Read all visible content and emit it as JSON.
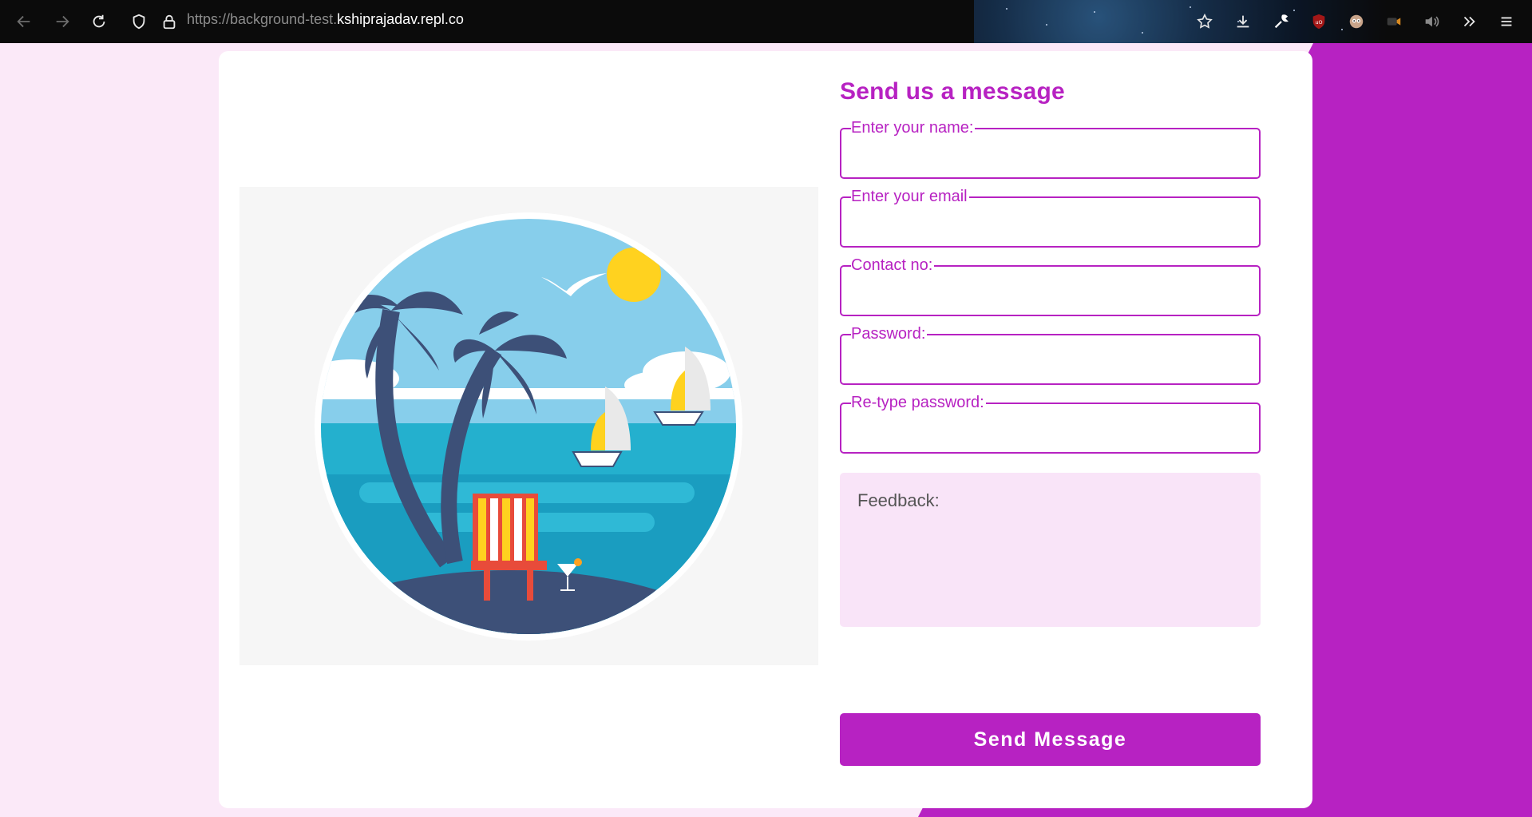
{
  "browser": {
    "url_prefix": "https://background-test.",
    "url_host": "kshiprajadav.repl.co",
    "icons": [
      "back-icon",
      "forward-icon",
      "reload-icon",
      "shield-icon",
      "lock-icon",
      "star-icon",
      "download-icon",
      "wrench-icon",
      "ublock-icon",
      "extension-face-icon",
      "extension-video-icon",
      "speaker-icon",
      "overflow-icon",
      "menu-icon"
    ]
  },
  "form": {
    "title": "Send us a message",
    "fields": [
      {
        "label": "Enter your name:",
        "value": ""
      },
      {
        "label": "Enter your email",
        "value": ""
      },
      {
        "label": "Contact no:",
        "value": ""
      },
      {
        "label": "Password:",
        "value": ""
      },
      {
        "label": "Re-type password:",
        "value": ""
      }
    ],
    "feedback_placeholder": "Feedback:",
    "submit_label": "Send Message"
  },
  "colors": {
    "accent": "#b722c2",
    "page_bg": "#fbe9f8",
    "feedback_bg": "#f9e4f8",
    "toolbar_bg": "#0b0b0b"
  }
}
